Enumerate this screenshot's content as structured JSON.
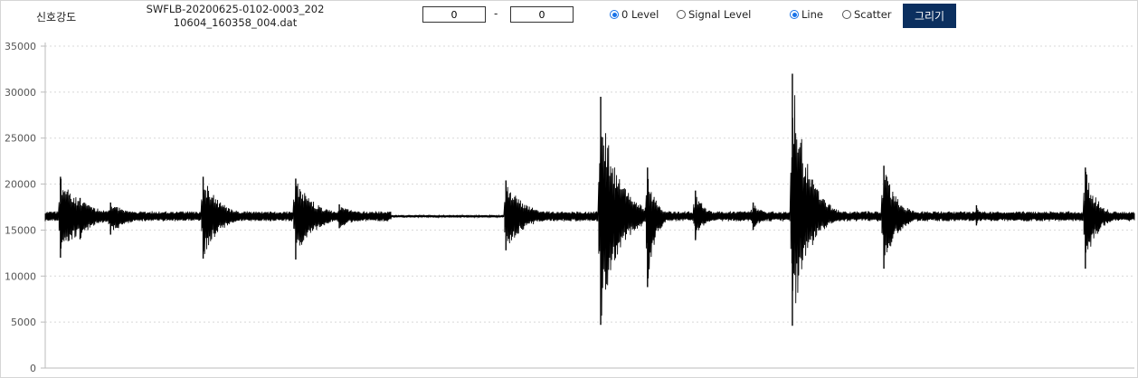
{
  "header": {
    "title": "신호강도",
    "filename": "SWFLB-20200625-0102-0003_20210604_160358_004.dat",
    "range_from": "0",
    "range_separator": "-",
    "range_to": "0",
    "level_options": [
      {
        "label": "0 Level",
        "selected": true
      },
      {
        "label": "Signal Level",
        "selected": false
      }
    ],
    "style_options": [
      {
        "label": "Line",
        "selected": true
      },
      {
        "label": "Scatter",
        "selected": false
      }
    ],
    "draw_button": "그리기"
  },
  "chart_data": {
    "type": "line",
    "title": "",
    "xlabel": "",
    "ylabel": "",
    "ylim": [
      0,
      35000
    ],
    "yticks": [
      "0",
      "5000",
      "10000",
      "15000",
      "20000",
      "25000",
      "30000",
      "35000"
    ],
    "grid": "horizontal dotted",
    "baseline": 16500,
    "series_color": "#000000",
    "series": [
      {
        "name": "",
        "bursts": [
          {
            "x": 0.014,
            "max": 20800,
            "min": 12000,
            "tail": 0.06
          },
          {
            "x": 0.032,
            "max": 18500,
            "min": 14000,
            "tail": 0.04
          },
          {
            "x": 0.06,
            "max": 18000,
            "min": 14500,
            "tail": 0.05
          },
          {
            "x": 0.145,
            "max": 20800,
            "min": 11900,
            "tail": 0.045
          },
          {
            "x": 0.23,
            "max": 20600,
            "min": 11800,
            "tail": 0.05
          },
          {
            "x": 0.27,
            "max": 17800,
            "min": 15200,
            "tail": 0.05
          },
          {
            "x": 0.423,
            "max": 20400,
            "min": 12800,
            "tail": 0.05
          },
          {
            "x": 0.51,
            "max": 29500,
            "min": 4700,
            "tail": 0.045
          },
          {
            "x": 0.553,
            "max": 21800,
            "min": 8800,
            "tail": 0.02
          },
          {
            "x": 0.597,
            "max": 19300,
            "min": 13900,
            "tail": 0.025
          },
          {
            "x": 0.65,
            "max": 18000,
            "min": 15000,
            "tail": 0.03
          },
          {
            "x": 0.686,
            "max": 32000,
            "min": 4600,
            "tail": 0.04
          },
          {
            "x": 0.77,
            "max": 22000,
            "min": 10800,
            "tail": 0.035
          },
          {
            "x": 0.855,
            "max": 17700,
            "min": 15500,
            "tail": 0.01
          },
          {
            "x": 0.955,
            "max": 21800,
            "min": 10800,
            "tail": 0.03
          }
        ],
        "quiet_segment": [
          0.318,
          0.423
        ]
      }
    ]
  }
}
